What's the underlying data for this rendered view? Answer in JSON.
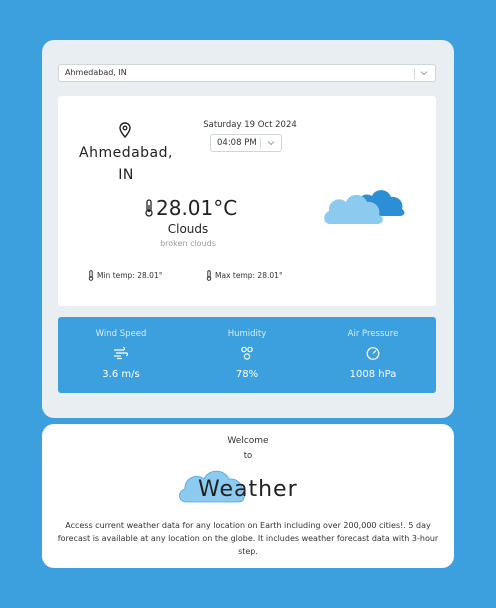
{
  "location_select": {
    "value": "Ahmedabad, IN"
  },
  "location": {
    "name_line1": "Ahmedabad,",
    "name_line2": "IN"
  },
  "datetime": {
    "date": "Saturday 19 Oct 2024",
    "time": "04:08 PM"
  },
  "current": {
    "temperature": "28.01°C",
    "condition": "Clouds",
    "description": "broken clouds",
    "min_temp": "Min temp: 28.01°",
    "max_temp": "Max temp: 28.01°"
  },
  "stats": [
    {
      "label": "Wind Speed",
      "value": "3.6 m/s",
      "icon": "wind-icon"
    },
    {
      "label": "Humidity",
      "value": "78%",
      "icon": "humidity-icon"
    },
    {
      "label": "Air Pressure",
      "value": "1008 hPa",
      "icon": "gauge-icon"
    }
  ],
  "welcome": {
    "line1": "Welcome",
    "line2": "to",
    "logo_text": "Weather",
    "description": "Access current weather data for any location on Earth including over 200,000 cities!. 5 day forecast is available at any location on the globe. It includes weather forecast data with 3-hour step."
  },
  "colors": {
    "background": "#3ca0de",
    "card": "#e8eef1",
    "cloud_light": "#8dcaf0",
    "cloud_dark": "#2c8fd6"
  }
}
